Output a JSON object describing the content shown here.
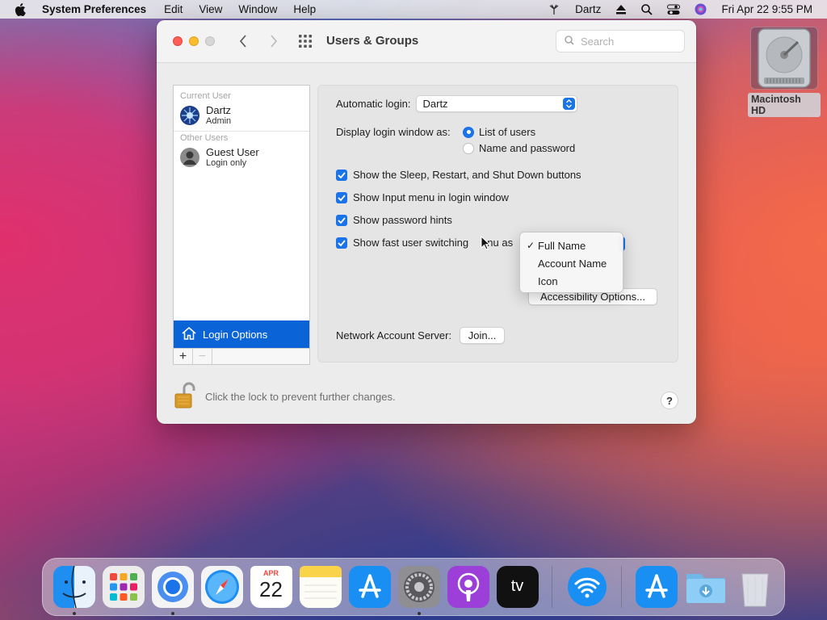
{
  "menubar": {
    "app_name": "System Preferences",
    "items": [
      "Edit",
      "View",
      "Window",
      "Help"
    ],
    "user": "Dartz",
    "datetime": "Fri Apr 22  9:55 PM"
  },
  "desktop": {
    "hd_label": "Macintosh HD"
  },
  "window": {
    "title": "Users & Groups",
    "search_placeholder": "Search"
  },
  "userlist": {
    "current_label": "Current User",
    "current_user": {
      "name": "Dartz",
      "role": "Admin"
    },
    "other_label": "Other Users",
    "other_user": {
      "name": "Guest User",
      "role": "Login only"
    },
    "login_options": "Login Options",
    "add": "+",
    "remove": "−"
  },
  "settings": {
    "auto_login_label": "Automatic login:",
    "auto_login_value": "Dartz",
    "display_label": "Display login window as:",
    "display_options": [
      "List of users",
      "Name and password"
    ],
    "display_selected": "List of users",
    "checkboxes": [
      {
        "label": "Show the Sleep, Restart, and Shut Down buttons",
        "checked": true
      },
      {
        "label": "Show Input menu in login window",
        "checked": true
      },
      {
        "label": "Show password hints",
        "checked": true
      },
      {
        "label": "Show fast user switching menu as",
        "checked": true
      }
    ],
    "fast_switch_visible_text": "Show fast user switching ",
    "fast_switch_visible_text2": "enu as",
    "accessibility_button": "Accessibility Options...",
    "network_label": "Network Account Server:",
    "join_button": "Join..."
  },
  "dropdown": {
    "options": [
      "Full Name",
      "Account Name",
      "Icon"
    ],
    "selected": "Full Name",
    "check": "✓"
  },
  "footer": {
    "lock_text": "Click the lock to prevent further changes.",
    "help": "?"
  },
  "dock": {
    "apps": [
      "finder-icon",
      "launchpad-icon",
      "chrome-icon",
      "safari-icon",
      "calendar-icon",
      "notes-icon",
      "app-store-icon",
      "system-preferences-icon",
      "podcasts-icon",
      "apple-tv-icon",
      "wifi-icon",
      "app-store-icon",
      "downloads-folder-icon",
      "trash-icon"
    ],
    "calendar_month": "APR",
    "calendar_day": "22",
    "tv_label": "tv"
  },
  "colors": {
    "accent": "#1a73e8",
    "selection": "#0a64d8"
  }
}
